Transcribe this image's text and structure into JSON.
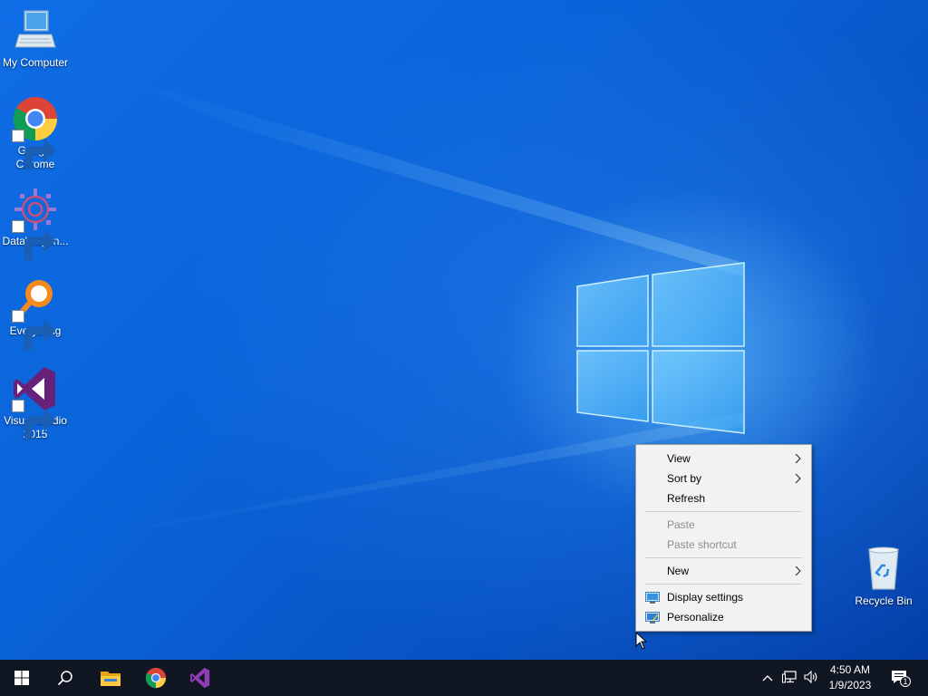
{
  "desktop": {
    "icons": [
      {
        "label": "My Computer",
        "icon": "computer-icon"
      },
      {
        "label": "Google Chrome",
        "icon": "chrome-icon"
      },
      {
        "label": "DataWagon...",
        "icon": "datawagon-icon"
      },
      {
        "label": "Everything",
        "icon": "everything-search-icon"
      },
      {
        "label": "Visual Studio 2015",
        "icon": "visual-studio-icon"
      },
      {
        "label": "Recycle Bin",
        "icon": "recycle-bin-icon"
      }
    ]
  },
  "context_menu": {
    "items": [
      {
        "label": "View",
        "submenu": true,
        "enabled": true
      },
      {
        "label": "Sort by",
        "submenu": true,
        "enabled": true
      },
      {
        "label": "Refresh",
        "submenu": false,
        "enabled": true
      },
      {
        "label": "Paste",
        "submenu": false,
        "enabled": false
      },
      {
        "label": "Paste shortcut",
        "submenu": false,
        "enabled": false
      },
      {
        "label": "New",
        "submenu": true,
        "enabled": true
      },
      {
        "label": "Display settings",
        "submenu": false,
        "enabled": true,
        "icon": "display-settings-icon"
      },
      {
        "label": "Personalize",
        "submenu": false,
        "enabled": true,
        "icon": "personalize-icon"
      }
    ]
  },
  "taskbar": {
    "pinned": [
      "start-icon",
      "search-icon",
      "file-explorer-icon",
      "chrome-icon",
      "visual-studio-icon"
    ],
    "tray": [
      "chevron-up-icon",
      "network-icon",
      "volume-icon",
      "action-center-icon"
    ],
    "clock": {
      "time": "4:50 AM",
      "date": "1/9/2023"
    },
    "notification_count": "1"
  },
  "colors": {
    "desktop_blue": "#0a63d8",
    "taskbar": "#101622",
    "menu_bg": "#f2f2f2",
    "disabled_text": "#8d8d8d"
  }
}
